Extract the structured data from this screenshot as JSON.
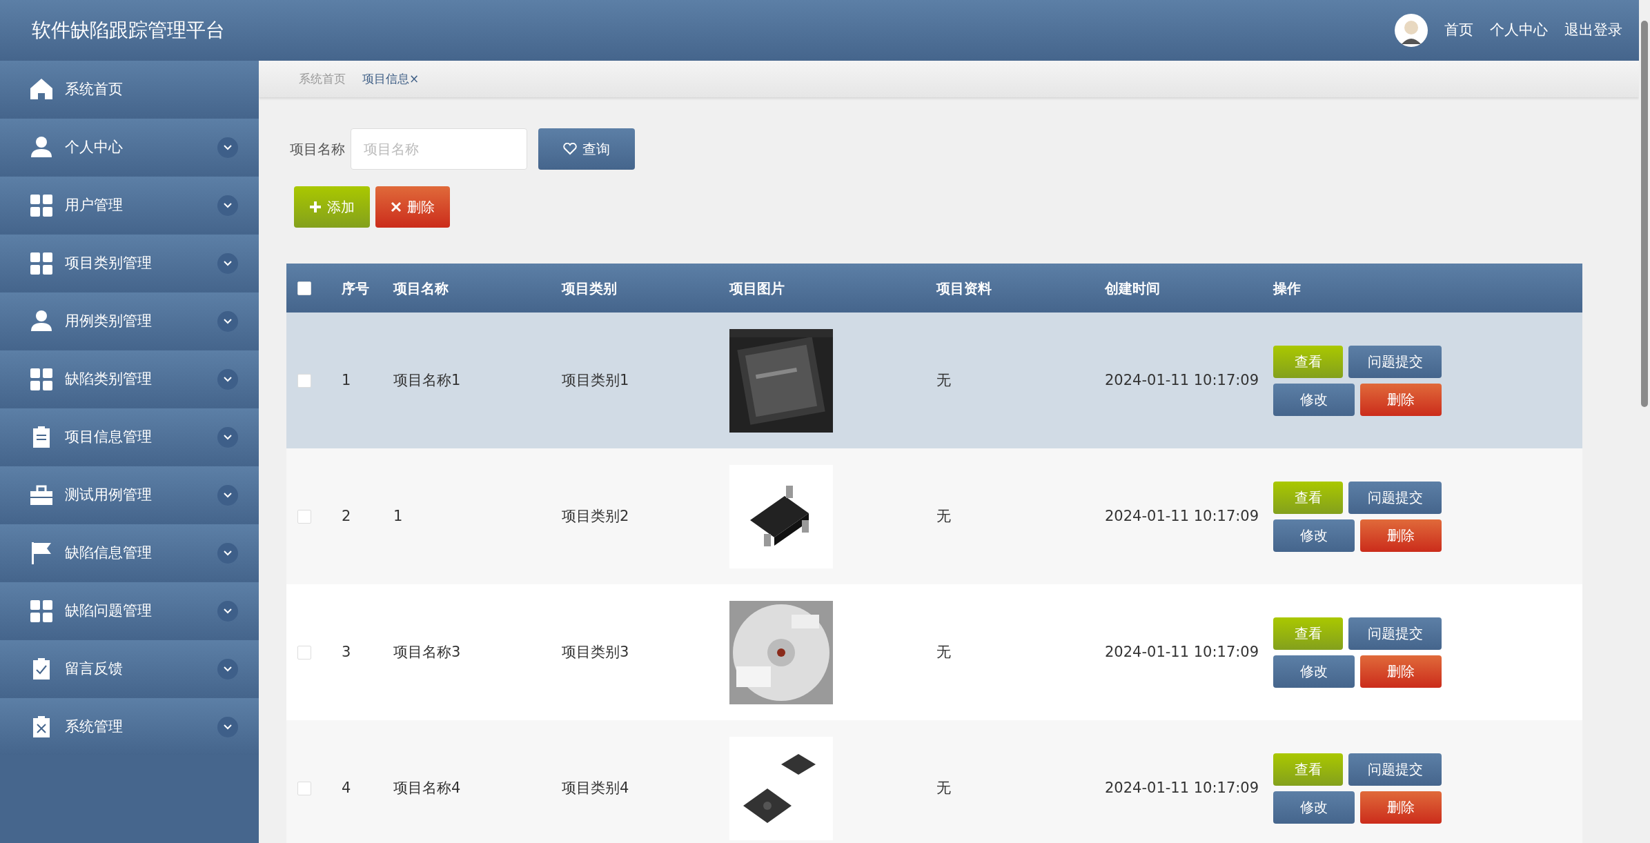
{
  "header": {
    "title": "软件缺陷跟踪管理平台",
    "links": [
      "首页",
      "个人中心",
      "退出登录"
    ]
  },
  "sidebar": {
    "items": [
      {
        "label": "系统首页",
        "expandable": false
      },
      {
        "label": "个人中心",
        "expandable": true
      },
      {
        "label": "用户管理",
        "expandable": true
      },
      {
        "label": "项目类别管理",
        "expandable": true
      },
      {
        "label": "用例类别管理",
        "expandable": true
      },
      {
        "label": "缺陷类别管理",
        "expandable": true
      },
      {
        "label": "项目信息管理",
        "expandable": true
      },
      {
        "label": "测试用例管理",
        "expandable": true
      },
      {
        "label": "缺陷信息管理",
        "expandable": true
      },
      {
        "label": "缺陷问题管理",
        "expandable": true
      },
      {
        "label": "留言反馈",
        "expandable": true
      },
      {
        "label": "系统管理",
        "expandable": true
      }
    ]
  },
  "tabs": [
    {
      "label": "系统首页",
      "selected": false
    },
    {
      "label": "项目信息",
      "close": "×",
      "selected": true
    }
  ],
  "search": {
    "label": "项目名称",
    "placeholder": "项目名称",
    "button": "查询"
  },
  "actions": [
    "添加",
    "删除"
  ],
  "table": {
    "all_checked": false,
    "columns": [
      "序号",
      "项目名称",
      "项目类别",
      "项目图片",
      "项目资料",
      "创建时间",
      "操作"
    ],
    "rows": [
      {
        "checked": false,
        "highlighted": true,
        "cells": [
          "1",
          "项目名称1",
          "项目类别1",
          {
            "kind": "picture"
          },
          "无",
          "2024-01-11 10:17:09",
          {
            "buttons": [
              "查看",
              "问题提交",
              "修改",
              "删除"
            ]
          }
        ]
      },
      {
        "checked": false,
        "highlighted": false,
        "cells": [
          "2",
          "1",
          "项目类别2",
          {
            "kind": "picture"
          },
          "无",
          "2024-01-11 10:17:09",
          {
            "buttons": [
              "查看",
              "问题提交",
              "修改",
              "删除"
            ]
          }
        ]
      },
      {
        "checked": false,
        "highlighted": false,
        "cells": [
          "3",
          "项目名称3",
          "项目类别3",
          {
            "kind": "picture"
          },
          "无",
          "2024-01-11 10:17:09",
          {
            "buttons": [
              "查看",
              "问题提交",
              "修改",
              "删除"
            ]
          }
        ]
      },
      {
        "checked": false,
        "highlighted": false,
        "cells": [
          "4",
          "项目名称4",
          "项目类别4",
          {
            "kind": "picture"
          },
          "无",
          "2024-01-11 10:17:09",
          {
            "buttons": [
              "查看",
              "问题提交",
              "修改",
              "删除"
            ]
          }
        ]
      }
    ]
  }
}
